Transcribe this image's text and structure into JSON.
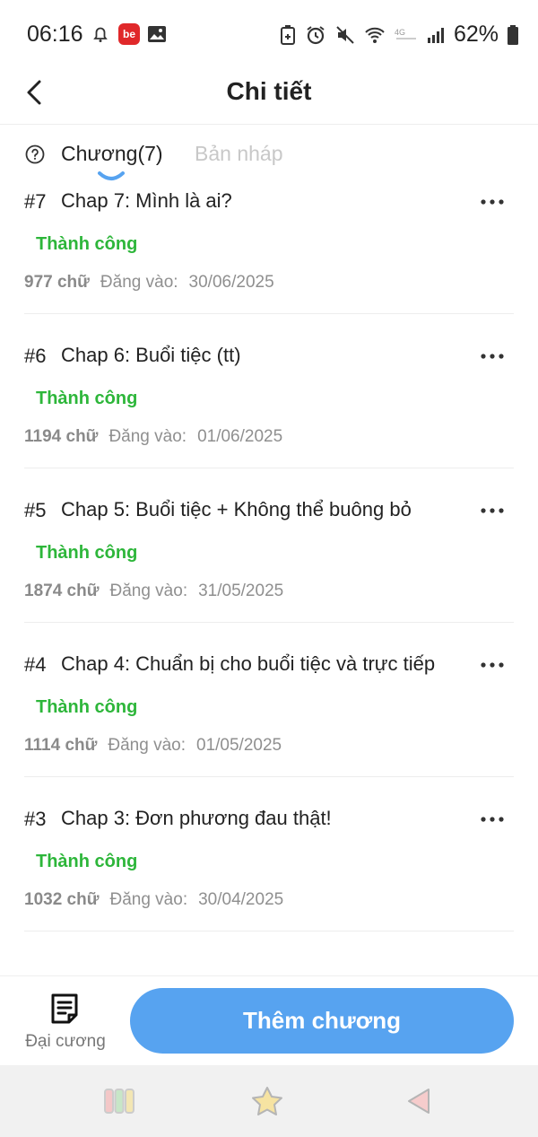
{
  "status_bar": {
    "time": "06:16",
    "battery_percent": "62%",
    "icons": [
      "alarm-bell-icon",
      "be-app-icon",
      "gallery-icon",
      "battery-saver-icon",
      "alarm-clock-icon",
      "mute-icon",
      "wifi-icon",
      "lte-icon",
      "signal-icon",
      "battery-icon"
    ],
    "be_badge": "be"
  },
  "header": {
    "title": "Chi tiết"
  },
  "tabs": [
    {
      "label": "Chương(7)",
      "active": true
    },
    {
      "label": "Bản nháp",
      "active": false
    }
  ],
  "chapters": [
    {
      "num": "#7",
      "title": "Chap 7: Mình là ai?",
      "status": "Thành công",
      "words": "977 chữ",
      "posted_label": "Đăng vào:",
      "date": "30/06/2025"
    },
    {
      "num": "#6",
      "title": "Chap 6: Buổi tiệc (tt)",
      "status": "Thành công",
      "words": "1194 chữ",
      "posted_label": "Đăng vào:",
      "date": "01/06/2025"
    },
    {
      "num": "#5",
      "title": "Chap 5: Buổi tiệc + Không thể buông bỏ",
      "status": "Thành công",
      "words": "1874 chữ",
      "posted_label": "Đăng vào:",
      "date": "31/05/2025"
    },
    {
      "num": "#4",
      "title": "Chap 4: Chuẩn bị cho buổi tiệc và trực tiếp",
      "status": "Thành công",
      "words": "1114 chữ",
      "posted_label": "Đăng vào:",
      "date": "01/05/2025"
    },
    {
      "num": "#3",
      "title": "Chap 3: Đơn phương đau thật!",
      "status": "Thành công",
      "words": "1032 chữ",
      "posted_label": "Đăng vào:",
      "date": "30/04/2025"
    }
  ],
  "bottom": {
    "outline_label": "Đại cương",
    "add_button": "Thêm chương"
  },
  "colors": {
    "accent": "#57a3f0",
    "success": "#2db63a",
    "muted": "#8f8f8f"
  }
}
